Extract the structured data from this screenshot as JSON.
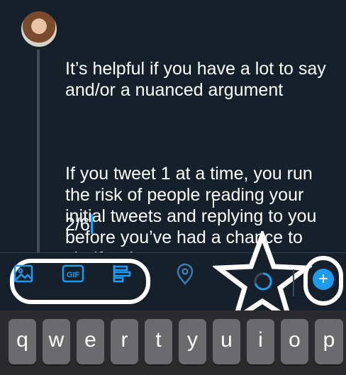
{
  "tweet": {
    "paragraph_1": "It’s helpful if you have a lot to say and/or a nuanced argument",
    "paragraph_2": "If you tweet 1 at a time, you run the risk of people reading your initial tweets and replying to you before you’ve had a chance to clarify what you mean",
    "counter": "2/6"
  },
  "toolbar": {
    "image_icon": "image-icon",
    "gif_label": "GIF",
    "poll_icon": "poll-icon",
    "location_icon": "location-pin-icon",
    "add_icon": "plus-icon",
    "add_label": "+"
  },
  "keyboard": {
    "keys": [
      "q",
      "w",
      "e",
      "r",
      "t",
      "y",
      "u",
      "i",
      "o",
      "p"
    ]
  },
  "colors": {
    "background": "#15202b",
    "accent": "#1d9bf0",
    "key": "#6b6b6d",
    "keyboard_bg": "#2b2b2d"
  }
}
